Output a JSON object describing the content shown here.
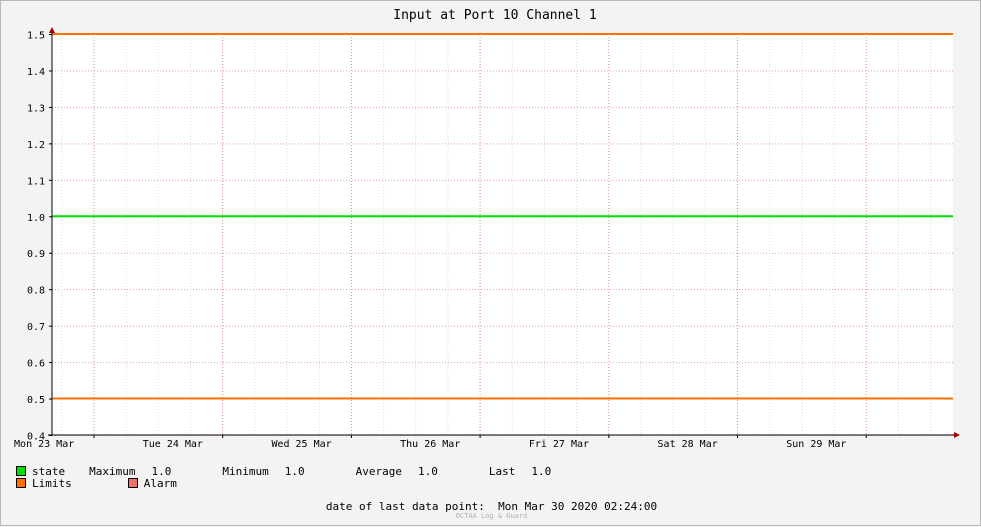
{
  "chart_data": {
    "type": "line",
    "title": "Input at Port 10 Channel 1",
    "xlabel": "",
    "ylabel": "",
    "ylim": [
      0.4,
      1.5
    ],
    "y_ticks": [
      "0.4",
      "0.5",
      "0.6",
      "0.7",
      "0.8",
      "0.9",
      "1.0",
      "1.1",
      "1.2",
      "1.3",
      "1.4",
      "1.5"
    ],
    "x_categories": [
      "Mon 23 Mar",
      "Tue 24 Mar",
      "Wed 25 Mar",
      "Thu 26 Mar",
      "Fri 27 Mar",
      "Sat 28 Mar",
      "Sun 29 Mar"
    ],
    "grid": true,
    "series": [
      {
        "name": "state",
        "color": "#00e000",
        "values": [
          1.0,
          1.0,
          1.0,
          1.0,
          1.0,
          1.0,
          1.0
        ]
      },
      {
        "name": "Limits",
        "color": "#ff7000",
        "values": [
          1.5,
          1.5,
          1.5,
          1.5,
          1.5,
          1.5,
          1.5
        ]
      },
      {
        "name": "Limits",
        "color": "#ff7000",
        "values": [
          0.5,
          0.5,
          0.5,
          0.5,
          0.5,
          0.5,
          0.5
        ]
      }
    ]
  },
  "legend": {
    "state_label": "state",
    "state_color": "#00e000",
    "max_label": "Maximum",
    "max_value": "1.0",
    "min_label": "Minimum",
    "min_value": "1.0",
    "avg_label": "Average",
    "avg_value": "1.0",
    "last_label": "Last",
    "last_value": "1.0",
    "limits_label": "Limits",
    "limits_color": "#ff7000",
    "alarm_label": "Alarm",
    "alarm_color": "#f07070"
  },
  "footer": {
    "last_point_label": "date of last data point:",
    "last_point_value": "Mon Mar 30 2020 02:24:00",
    "watermark": "OCTAA Log & Guard"
  }
}
